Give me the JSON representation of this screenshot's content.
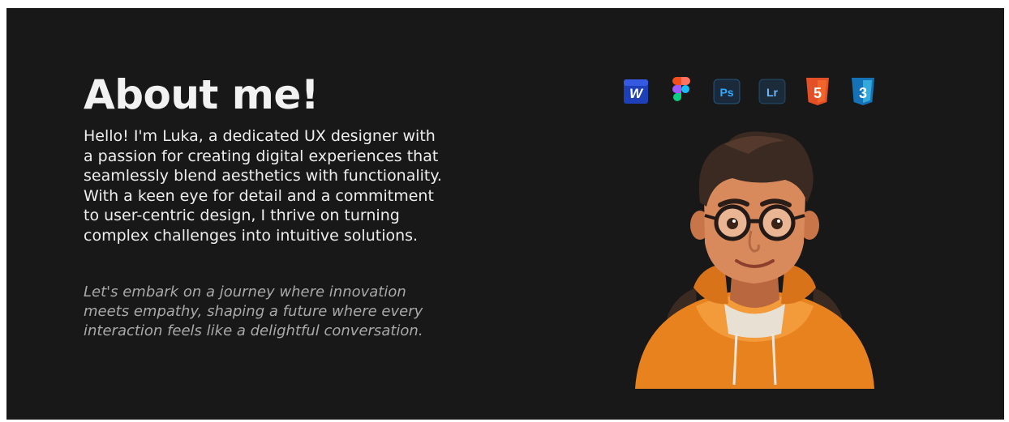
{
  "about": {
    "title": "About me!",
    "intro": "Hello! I'm Luka, a dedicated UX designer with a passion for creating digital experiences that seamlessly blend aesthetics with functionality. With a keen eye for detail and a commitment to user-centric design, I thrive on turning complex challenges into intuitive solutions.",
    "quote": "Let's embark on a journey where innovation meets empathy, shaping a future where every interaction feels like a delightful conversation."
  },
  "tools": [
    {
      "icon": "word-icon",
      "label": "W"
    },
    {
      "icon": "figma-icon",
      "label": ""
    },
    {
      "icon": "photoshop-icon",
      "label": "Ps"
    },
    {
      "icon": "lightroom-icon",
      "label": "Lr"
    },
    {
      "icon": "html5-icon",
      "label": "5"
    },
    {
      "icon": "css3-icon",
      "label": "3"
    }
  ],
  "colors": {
    "background": "#181818",
    "title": "#f2f2f2",
    "body_text": "#eeeeee",
    "quote_text": "#a9a9a9",
    "hoodie": "#e8821e"
  }
}
